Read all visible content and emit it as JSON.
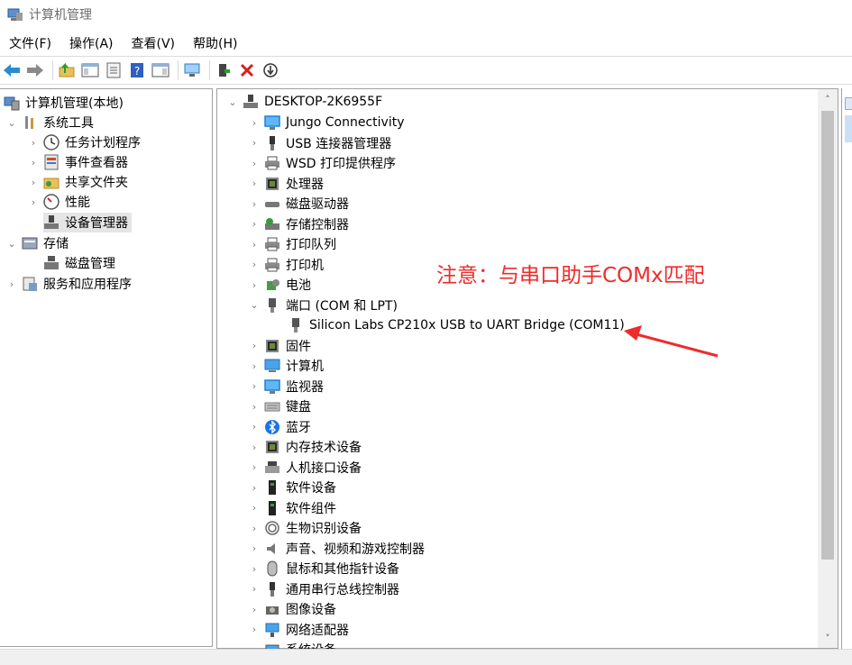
{
  "window": {
    "title": "计算机管理"
  },
  "menu": {
    "items": [
      "文件(F)",
      "操作(A)",
      "查看(V)",
      "帮助(H)"
    ]
  },
  "toolbar": {
    "buttons": [
      "back-icon",
      "forward-icon",
      "up-folder-icon",
      "show-hide-tree-icon",
      "properties-icon",
      "help-icon",
      "action-pane-icon",
      "scan-hardware-icon",
      "update-driver-icon",
      "uninstall-icon",
      "disable-icon"
    ]
  },
  "tree": {
    "root": "计算机管理(本地)",
    "items": [
      {
        "label": "系统工具",
        "icon": "tools-icon"
      },
      {
        "label": "任务计划程序",
        "icon": "clock-icon"
      },
      {
        "label": "事件查看器",
        "icon": "event-viewer-icon"
      },
      {
        "label": "共享文件夹",
        "icon": "shared-folder-icon"
      },
      {
        "label": "性能",
        "icon": "performance-icon"
      },
      {
        "label": "设备管理器",
        "icon": "device-manager-icon"
      },
      {
        "label": "存储",
        "icon": "storage-icon"
      },
      {
        "label": "磁盘管理",
        "icon": "disk-management-icon"
      },
      {
        "label": "服务和应用程序",
        "icon": "services-icon"
      }
    ]
  },
  "devices": {
    "computer": "DESKTOP-2K6955F",
    "categories": [
      "Jungo Connectivity",
      "USB 连接器管理器",
      "WSD 打印提供程序",
      "处理器",
      "磁盘驱动器",
      "存储控制器",
      "打印队列",
      "打印机",
      "电池",
      "端口 (COM 和 LPT)",
      "固件",
      "计算机",
      "监视器",
      "键盘",
      "蓝牙",
      "内存技术设备",
      "人机接口设备",
      "软件设备",
      "软件组件",
      "生物识别设备",
      "声音、视频和游戏控制器",
      "鼠标和其他指针设备",
      "通用串行总线控制器",
      "图像设备",
      "网络适配器",
      "系统设备"
    ],
    "port_child": "Silicon Labs CP210x USB to UART Bridge (COM11)"
  },
  "annotation": {
    "text": "注意：与串口助手COMx匹配",
    "color": "#ee2b2b"
  },
  "colors": {
    "selection": "#e5e5e5",
    "accent": "#1f7fd8",
    "annotation": "#ee2b2b"
  }
}
